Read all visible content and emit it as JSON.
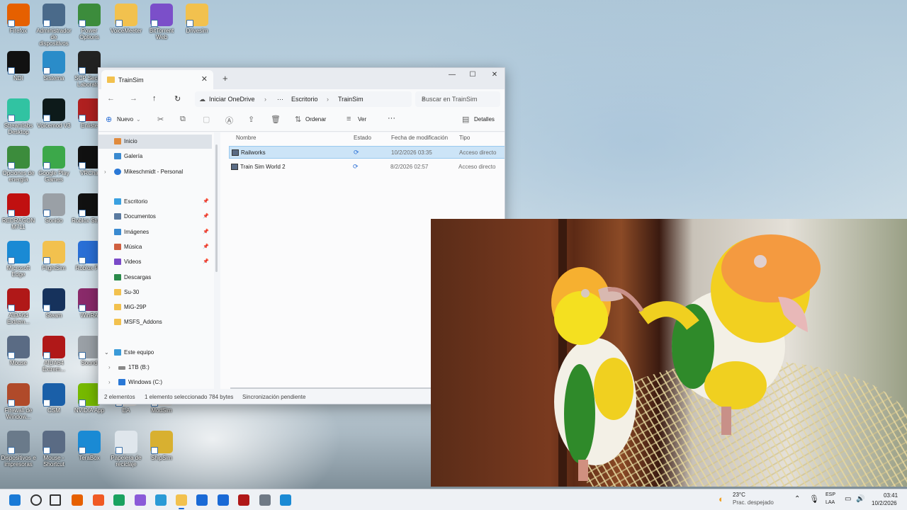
{
  "desktop": {
    "icons": [
      {
        "label": "Firefox",
        "icon": "firefox-icon",
        "color": "#e66000"
      },
      {
        "label": "Administrador de dispositivos",
        "icon": "device-manager-icon",
        "color": "#4a6a8a"
      },
      {
        "label": "Power Options",
        "icon": "power-icon",
        "color": "#3c8c3c"
      },
      {
        "label": "VoiceMeeter",
        "icon": "folder-icon",
        "color": "#f2c14e"
      },
      {
        "label": "BitTorrent Web",
        "icon": "bittorrent-icon",
        "color": "#7b4fc9"
      },
      {
        "label": "Drivesim",
        "icon": "folder-icon",
        "color": "#f2c14e"
      },
      {
        "label": "NDI",
        "icon": "ndi-icon",
        "color": "#111111"
      },
      {
        "label": "Sistema",
        "icon": "system-icon",
        "color": "#2a8cc9"
      },
      {
        "label": "SCP Secret Laborator",
        "icon": "scp-icon",
        "color": "#222222"
      },
      {
        "label": "Streamlabs Desktop",
        "icon": "streamlabs-icon",
        "color": "#31c3a2"
      },
      {
        "label": "Voicemod V3",
        "icon": "voicemod-icon",
        "color": "#0d1a1a"
      },
      {
        "label": "Enliste",
        "icon": "enlisted-icon",
        "color": "#b02020"
      },
      {
        "label": "Opciones de energía",
        "icon": "energy-icon",
        "color": "#3c8c3c"
      },
      {
        "label": "Google Play Games",
        "icon": "google-play-games-icon",
        "color": "#3ca84a"
      },
      {
        "label": "VRCha",
        "icon": "vrchat-icon",
        "color": "#111111"
      },
      {
        "label": "REDRAGON M711",
        "icon": "redragon-icon",
        "color": "#c01010"
      },
      {
        "label": "Sonido",
        "icon": "speaker-icon",
        "color": "#9aa0a6"
      },
      {
        "label": "Roblox Studio",
        "icon": "roblox-studio-icon",
        "color": "#111111"
      },
      {
        "label": "Microsoft Edge",
        "icon": "edge-icon",
        "color": "#1a8ad4"
      },
      {
        "label": "FlightSim",
        "icon": "folder-icon",
        "color": "#f2c14e"
      },
      {
        "label": "Roblox Pla",
        "icon": "roblox-icon",
        "color": "#2a6fd6"
      },
      {
        "label": "AIDA64 Extrem...",
        "icon": "aida64-icon",
        "color": "#b01818"
      },
      {
        "label": "Steam",
        "icon": "steam-icon",
        "color": "#16325c"
      },
      {
        "label": "WinRA",
        "icon": "winrar-icon",
        "color": "#8a2a6a"
      },
      {
        "label": "Mouse",
        "icon": "mouse-icon",
        "color": "#5a6b84"
      },
      {
        "label": "AIDA64 Extrem...",
        "icon": "aida64-icon",
        "color": "#b01818"
      },
      {
        "label": "Sound",
        "icon": "speaker-icon",
        "color": "#9aa0a6"
      },
      {
        "label": "Firewall de Window...",
        "icon": "firewall-icon",
        "color": "#b04a2a"
      },
      {
        "label": "CSM",
        "icon": "csm-icon",
        "color": "#1a5fa8"
      },
      {
        "label": "NVIDIA App",
        "icon": "nvidia-icon",
        "color": "#76b900"
      },
      {
        "label": "EA",
        "icon": "ea-icon",
        "color": "#e0e0e0"
      },
      {
        "label": "ModSim",
        "icon": "modsim-icon",
        "color": "#d0d0d0"
      },
      {
        "label": "Dispositivos e impresoras",
        "icon": "printer-icon",
        "color": "#6a7a8a"
      },
      {
        "label": "Mouse - Shortcut",
        "icon": "mouse-icon",
        "color": "#5a6b84"
      },
      {
        "label": "TeraBox",
        "icon": "terabox-icon",
        "color": "#1a8ad4"
      },
      {
        "label": "Papelera de reciclaje",
        "icon": "recycle-bin-icon",
        "color": "#dfe6ec"
      },
      {
        "label": "ShipSim",
        "icon": "shipsim-icon",
        "color": "#d8b030"
      }
    ]
  },
  "explorer": {
    "tab_title": "TrainSim",
    "new_tab": "+",
    "controls": {
      "minimize": "—",
      "maximize": "☐",
      "close": "✕"
    },
    "breadcrumb": [
      "Iniciar OneDrive",
      "···",
      "Escritorio",
      "TrainSim"
    ],
    "search_placeholder": "Buscar en TrainSim",
    "commands": {
      "new": "Nuevo",
      "sort": "Ordenar",
      "view": "Ver",
      "more": "···",
      "details": "Detalles"
    },
    "nav": {
      "home": "Inicio",
      "gallery": "Galería",
      "onedrive": "Mikeschmidt - Personal",
      "quick": [
        {
          "label": "Escritorio",
          "color": "#3aa0e0",
          "pinned": true
        },
        {
          "label": "Documentos",
          "color": "#5a7aa0",
          "pinned": true
        },
        {
          "label": "Imágenes",
          "color": "#3a8ad0",
          "pinned": true
        },
        {
          "label": "Música",
          "color": "#d06040",
          "pinned": true
        },
        {
          "label": "Videos",
          "color": "#7a4ac8",
          "pinned": true
        },
        {
          "label": "Descargas",
          "color": "#2a8a4a",
          "pinned": false
        },
        {
          "label": "Su-30",
          "color": "#f2c14e",
          "pinned": false
        },
        {
          "label": "MiG-29P",
          "color": "#f2c14e",
          "pinned": false
        },
        {
          "label": "MSFS_Addons",
          "color": "#f2c14e",
          "pinned": false
        }
      ],
      "this_pc": "Este equipo",
      "drives": [
        "1TB (B:)",
        "Windows (C:)"
      ]
    },
    "columns": [
      "Nombre",
      "Estado",
      "Fecha de modificación",
      "Tipo"
    ],
    "rows": [
      {
        "name": "Railworks",
        "status": "sync",
        "date": "10/2/2026 03:35",
        "type": "Acceso directo",
        "selected": true
      },
      {
        "name": "Train Sim World 2",
        "status": "sync",
        "date": "8/2/2026 02:57",
        "type": "Acceso directo",
        "selected": false
      }
    ],
    "status_bar": {
      "count": "2 elementos",
      "selection": "1 elemento seleccionado  784 bytes",
      "sync": "Sincronización pendiente"
    }
  },
  "taskbar": {
    "weather_temp": "23°C",
    "weather_desc": "Prac. despejado",
    "lang_top": "ESP",
    "lang_bottom": "LAA",
    "time": "03:41",
    "date": "10/2/2026",
    "apps": [
      "start-icon",
      "search-icon",
      "task-view-icon",
      "firefox-icon",
      "brave-icon",
      "chrome-icon",
      "copilot-icon",
      "snipping-icon",
      "file-explorer-icon",
      "store-icon",
      "outlook-icon",
      "aida64-icon",
      "settings-icon",
      "terabox-icon"
    ]
  }
}
